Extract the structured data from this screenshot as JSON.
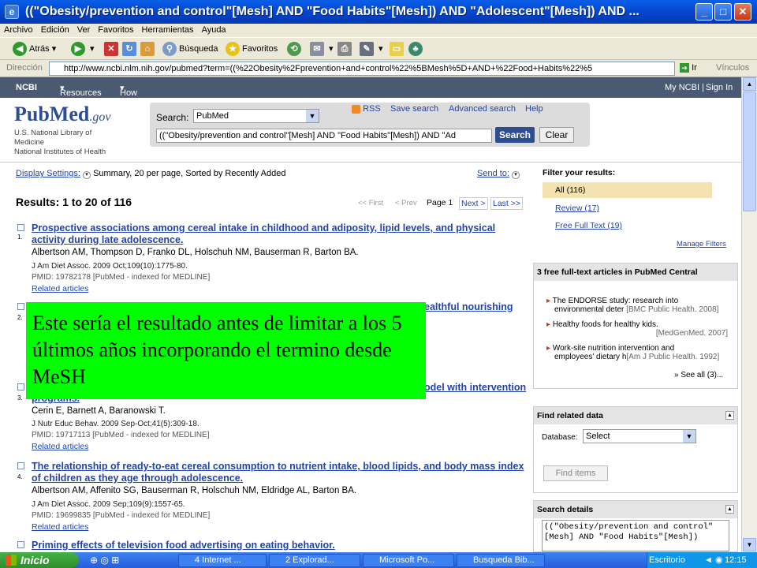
{
  "window": {
    "title": "((\"Obesity/prevention and control\"[Mesh] AND \"Food Habits\"[Mesh]) AND \"Adolescent\"[Mesh]) AND ...",
    "minimize": "_",
    "maximize": "□",
    "close": "✕"
  },
  "menu": [
    "Archivo",
    "Edición",
    "Ver",
    "Favoritos",
    "Herramientas",
    "Ayuda"
  ],
  "toolbar": {
    "back": "Atrás",
    "search": "Búsqueda",
    "favorites": "Favoritos"
  },
  "address": {
    "label": "Dirección",
    "url": "http://www.ncbi.nlm.nih.gov/pubmed?term=((%22Obesity%2Fprevention+and+control%22%5BMesh%5D+AND+%22Food+Habits%22%5",
    "go": "Ir",
    "links": "Vínculos"
  },
  "ncbi": {
    "logo": "NCBI",
    "resources": "Resources",
    "howto": "How To",
    "myncbi": "My NCBI",
    "signin": "Sign In"
  },
  "pubmed": {
    "logo": "PubMed",
    "gov": ".gov",
    "org_lines": [
      "U.S. National Library of",
      "Medicine",
      "National Institutes of Health"
    ],
    "search_label": "Search:",
    "db": "PubMed",
    "rss": "RSS",
    "save_search": "Save search",
    "advanced": "Advanced search",
    "help": "Help",
    "query": "((\"Obesity/prevention and control\"[Mesh] AND \"Food Habits\"[Mesh]) AND \"Ad",
    "search_btn": "Search",
    "clear_btn": "Clear"
  },
  "display": {
    "settings": "Display Settings:",
    "summary": "Summary, 20 per page, Sorted by Recently Added",
    "sendto": "Send to:"
  },
  "results_header": "Results: 1 to 20 of 116",
  "pager": {
    "first": "<< First",
    "prev": "< Prev",
    "page": "Page 1",
    "next": "Next >",
    "last": "Last >>"
  },
  "results": [
    {
      "num": "1.",
      "title_l1": "Prospective associations among cereal intake in childhood and adiposity, lipid levels, and physical",
      "title_l2": "activity during late adolescence.",
      "authors": "Albertson AM, Thompson D, Franko DL, Holschuh NM, Bauserman R, Barton BA.",
      "journal": "J Am Diet Assoc. 2009 Oct;109(10):1775-80.",
      "pmid": "PMID: 19782178 [PubMed - indexed for MEDLINE]",
      "related": "Related articles"
    },
    {
      "num": "2.",
      "title_l1": "ealthful nourishing"
    },
    {
      "num": "3.",
      "title_l1": "odel with intervention",
      "title_l2": "programs.",
      "authors": "Cerin E, Barnett A, Baranowski T.",
      "journal": "J Nutr Educ Behav. 2009 Sep-Oct;41(5):309-18.",
      "pmid": "PMID: 19717113 [PubMed - indexed for MEDLINE]",
      "related": "Related articles"
    },
    {
      "num": "4.",
      "title_l1": "The relationship of ready-to-eat cereal consumption to nutrient intake, blood lipids, and body mass index",
      "title_l2": "of children as they age through adolescence.",
      "authors": "Albertson AM, Affenito SG, Bauserman R, Holschuh NM, Eldridge AL, Barton BA.",
      "journal": "J Am Diet Assoc. 2009 Sep;109(9):1557-65.",
      "pmid": "PMID: 19699835 [PubMed - indexed for MEDLINE]",
      "related": "Related articles"
    },
    {
      "num": "5.",
      "title_l1": "Priming effects of television food advertising on eating behavior."
    }
  ],
  "filter": {
    "title": "Filter your results:",
    "items": [
      "All (116)",
      "Review (17)",
      "Free Full Text (19)"
    ],
    "manage": "Manage Filters"
  },
  "pmc": {
    "title": "3 free full-text articles in PubMed Central",
    "items": [
      {
        "line1": "The ENDORSE study: research into",
        "line2": "environmental deter",
        "src": "[BMC Public Health. 2008]"
      },
      {
        "line1": "Healthy foods for healthy kids.",
        "src": "[MedGenMed. 2007]"
      },
      {
        "line1": "Work-site nutrition intervention and",
        "line2": "employees' dietary h",
        "src": "[Am J Public Health. 1992]"
      }
    ],
    "see_all": "» See all (3)..."
  },
  "related": {
    "title": "Find related data",
    "db_label": "Database:",
    "select": "Select",
    "find_btn": "Find items"
  },
  "details": {
    "title": "Search details",
    "text": "((\"Obesity/prevention and control\"[Mesh] AND \"Food Habits\"[Mesh]) "
  },
  "overlay_text": "Este sería el resultado antes de limitar a los 5 últimos años incorporando el termino desde MeSH",
  "taskbar": {
    "start": "Inicio",
    "tasks": [
      "4 Internet ...",
      "2 Explorad...",
      "Microsoft Po...",
      "Busqueda Bib..."
    ],
    "desk": "Escritorio",
    "time": "12:15"
  },
  "colors": {
    "title_bar": "#0a5ee8",
    "ncbi_bar": "#4a5a73",
    "overlay": "#00ff00",
    "link": "#2244aa",
    "taskbar": "#245edb"
  }
}
